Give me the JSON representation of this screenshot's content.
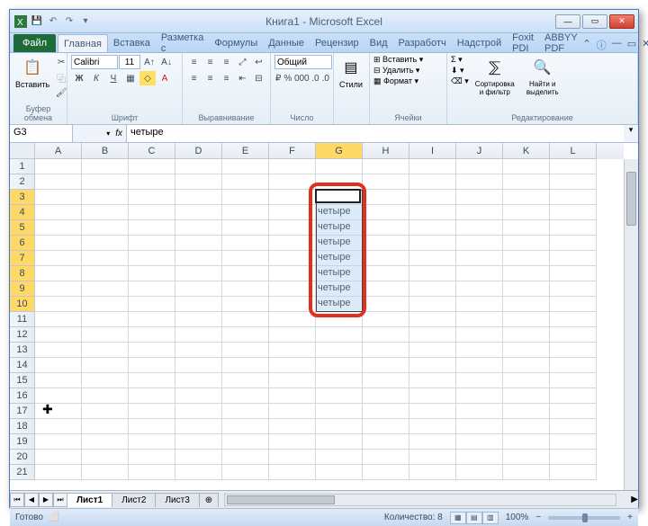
{
  "title": "Книга1 - Microsoft Excel",
  "file_tab": "Файл",
  "tabs": [
    "Главная",
    "Вставка",
    "Разметка с",
    "Формулы",
    "Данные",
    "Рецензир",
    "Вид",
    "Разработч",
    "Надстрой",
    "Foxit PDI",
    "ABBYY PDF"
  ],
  "ribbon": {
    "clipboard": {
      "label": "Буфер обмена",
      "paste": "Вставить"
    },
    "font": {
      "label": "Шрифт",
      "name": "Calibri",
      "size": "11"
    },
    "alignment": {
      "label": "Выравнивание"
    },
    "number": {
      "label": "Число",
      "format": "Общий"
    },
    "styles": {
      "label": "Стили",
      "btn": "Стили"
    },
    "cells": {
      "label": "Ячейки",
      "insert": "Вставить",
      "delete": "Удалить",
      "format": "Формат"
    },
    "editing": {
      "label": "Редактирование",
      "sort": "Сортировка и фильтр",
      "find": "Найти и выделить"
    }
  },
  "name_box": "G3",
  "fx": "fx",
  "formula_value": "четыре",
  "columns": [
    "A",
    "B",
    "C",
    "D",
    "E",
    "F",
    "G",
    "H",
    "I",
    "J",
    "K",
    "L"
  ],
  "rows": [
    "1",
    "2",
    "3",
    "4",
    "5",
    "6",
    "7",
    "8",
    "9",
    "10",
    "11",
    "12",
    "13",
    "14",
    "15",
    "16",
    "17",
    "18",
    "19",
    "20",
    "21"
  ],
  "cell_values": {
    "G3": "четыре",
    "G4": "четыре",
    "G5": "четыре",
    "G6": "четыре",
    "G7": "четыре",
    "G8": "четыре",
    "G9": "четыре",
    "G10": "четыре"
  },
  "selection": {
    "col": "G",
    "rows_from": 3,
    "rows_to": 10,
    "active": "G3"
  },
  "sheets": [
    "Лист1",
    "Лист2",
    "Лист3"
  ],
  "status": {
    "ready": "Готово",
    "count_label": "Количество:",
    "count_value": "8",
    "zoom": "100%"
  }
}
